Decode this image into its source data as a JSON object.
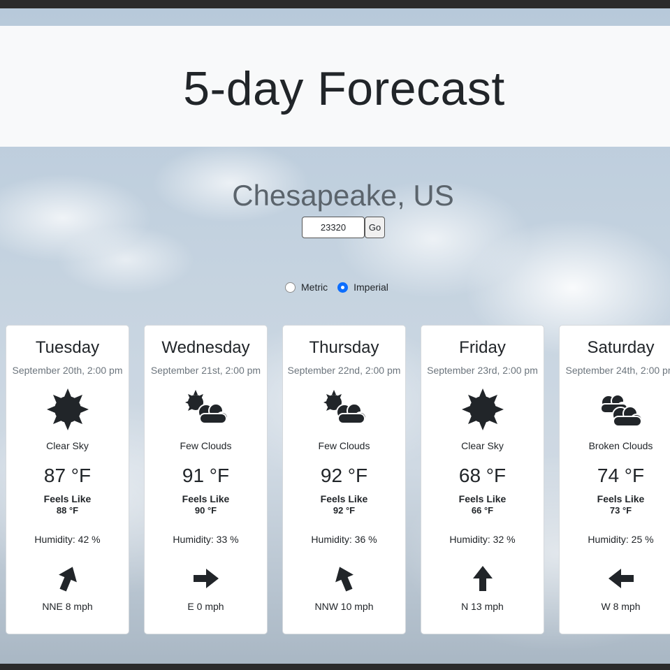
{
  "header": {
    "title": "5-day Forecast"
  },
  "location": {
    "city": "Chesapeake, US"
  },
  "search": {
    "zip_value": "23320",
    "go_label": "Go"
  },
  "units": {
    "metric_label": "Metric",
    "imperial_label": "Imperial",
    "selected": "Imperial"
  },
  "colors": {
    "radio_accent": "#0d6efd",
    "icon_fill": "#212529",
    "card_bg": "#ffffff"
  },
  "forecast": [
    {
      "day": "Tuesday",
      "date": "September 20th, 2:00 pm",
      "icon": "sun-icon",
      "desc": "Clear Sky",
      "temp": "87 °F",
      "feels_like_label": "Feels Like",
      "feels_like": "88 °F",
      "humidity": "Humidity: 42 %",
      "wind_direction": "NNE",
      "wind_deg": 22.5,
      "wind": "NNE 8 mph"
    },
    {
      "day": "Wednesday",
      "date": "September 21st, 2:00 pm",
      "icon": "sun-cloud-icon",
      "desc": "Few Clouds",
      "temp": "91 °F",
      "feels_like_label": "Feels Like",
      "feels_like": "90 °F",
      "humidity": "Humidity: 33 %",
      "wind_direction": "E",
      "wind_deg": 90,
      "wind": "E 0 mph"
    },
    {
      "day": "Thursday",
      "date": "September 22nd, 2:00 pm",
      "icon": "sun-cloud-icon",
      "desc": "Few Clouds",
      "temp": "92 °F",
      "feels_like_label": "Feels Like",
      "feels_like": "92 °F",
      "humidity": "Humidity: 36 %",
      "wind_direction": "NNW",
      "wind_deg": -22.5,
      "wind": "NNW 10 mph"
    },
    {
      "day": "Friday",
      "date": "September 23rd, 2:00 pm",
      "icon": "sun-icon",
      "desc": "Clear Sky",
      "temp": "68 °F",
      "feels_like_label": "Feels Like",
      "feels_like": "66 °F",
      "humidity": "Humidity: 32 %",
      "wind_direction": "N",
      "wind_deg": 0,
      "wind": "N 13 mph"
    },
    {
      "day": "Saturday",
      "date": "September 24th, 2:00 pm",
      "icon": "clouds-icon",
      "desc": "Broken Clouds",
      "temp": "74 °F",
      "feels_like_label": "Feels Like",
      "feels_like": "73 °F",
      "humidity": "Humidity: 25 %",
      "wind_direction": "W",
      "wind_deg": -90,
      "wind": "W 8 mph"
    }
  ]
}
